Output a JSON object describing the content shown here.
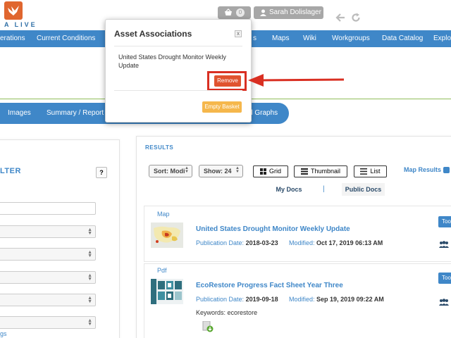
{
  "header": {
    "logo_text": "A LIVE",
    "basket_count": "0",
    "user_name": "Sarah Dolislager"
  },
  "nav": {
    "items": [
      "erations",
      "Current Conditions",
      "s",
      "Maps",
      "Wiki",
      "Workgroups",
      "Data Catalog",
      "Explor"
    ]
  },
  "subtabs": {
    "items": [
      "Images",
      "Summary / Report",
      "d Graphs"
    ]
  },
  "filter": {
    "heading": "LTER",
    "help_label": "?",
    "tags_link": "gs"
  },
  "results": {
    "label": "RESULTS",
    "sort_label": "Sort: Modi",
    "show_label": "Show: 24",
    "grid_label": "Grid",
    "thumbnail_label": "Thumbnail",
    "list_label": "List",
    "map_results_label": "Map Results",
    "tabs": {
      "my_docs": "My Docs",
      "separator": "|",
      "public_docs": "Public Docs"
    },
    "cards": [
      {
        "type": "Map",
        "title": "United States Drought Monitor Weekly Update",
        "pub_label": "Publication Date:",
        "pub_date": "2018-03-23",
        "mod_label": "Modified:",
        "mod_date": "Oct 17, 2019 06:13 AM",
        "tool_label": "Too"
      },
      {
        "type": "Pdf",
        "title": "EcoRestore Progress Fact Sheet Year Three",
        "pub_label": "Publication Date:",
        "pub_date": "2019-09-18",
        "mod_label": "Modified:",
        "mod_date": "Sep 19, 2019 09:22 AM",
        "keywords_label": "Keywords:",
        "keywords": "ecorestore",
        "tool_label": "Too"
      }
    ]
  },
  "dialog": {
    "title": "Asset Associations",
    "close_label": "x",
    "item_text": "United States Drought Monitor Weekly Update",
    "remove_label": "Remove",
    "empty_label": "Empty Basket"
  },
  "colors": {
    "nav_blue": "#3f87c8",
    "remove_red": "#e0532f",
    "highlight_red": "#d92f22",
    "empty_orange": "#f5b74c",
    "green_rule": "#8fbe5a"
  }
}
